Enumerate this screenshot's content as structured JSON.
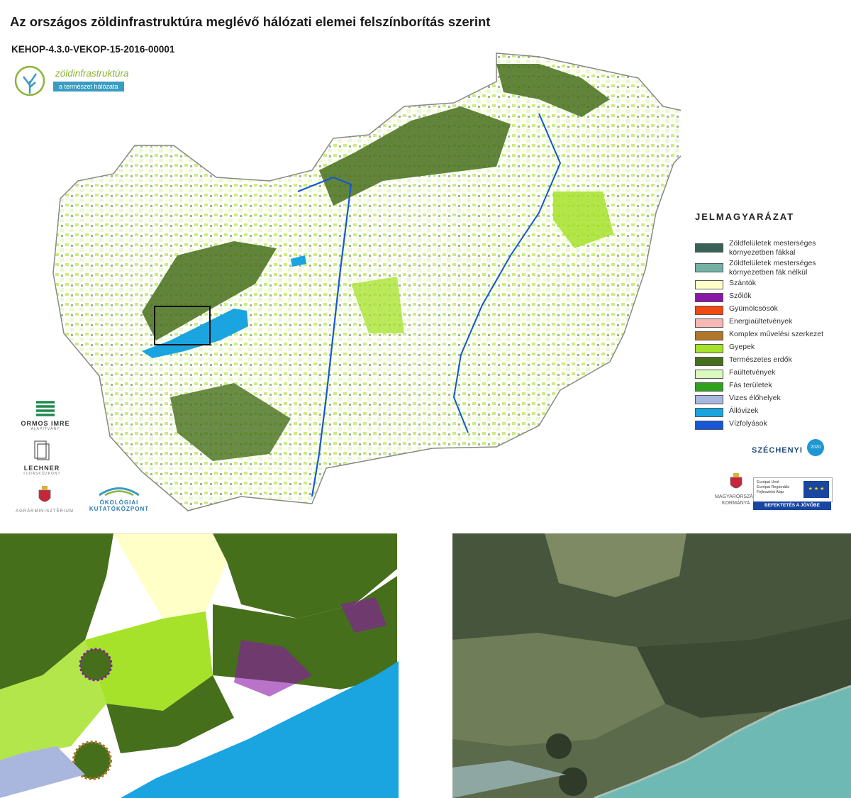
{
  "title": "Az országos zöldinfrastruktúra meglévő hálózati elemei felszínborítás szerint",
  "subtitle": "KEHOP-4.3.0-VEKOP-15-2016-00001",
  "logo": {
    "name": "zöldinfrastruktúra",
    "tagline": "a természet hálózata"
  },
  "legend": {
    "title": "JELMAGYARÁZAT",
    "items": [
      {
        "label": "Zöldfelületek mesterséges környezetben fákkal",
        "color": "#3a6158"
      },
      {
        "label": "Zöldfelületek mesterséges környezetben fák nélkül",
        "color": "#75b0a4"
      },
      {
        "label": "Szántók",
        "color": "#ffffc8"
      },
      {
        "label": "Szőlők",
        "color": "#8b17a6"
      },
      {
        "label": "Gyümölcsösök",
        "color": "#ef4a0f"
      },
      {
        "label": "Energiaültetvények",
        "color": "#f7b7b5"
      },
      {
        "label": "Komplex művelési szerkezet",
        "color": "#b0772a"
      },
      {
        "label": "Gyepek",
        "color": "#a6e22a"
      },
      {
        "label": "Természetes erdők",
        "color": "#466f1b"
      },
      {
        "label": "Faültetvények",
        "color": "#d9f9be"
      },
      {
        "label": "Fás területek",
        "color": "#2fa21c"
      },
      {
        "label": "Vizes élőhelyek",
        "color": "#a9b7df"
      },
      {
        "label": "Állóvizek",
        "color": "#1aa4e0"
      },
      {
        "label": "Vízfolyások",
        "color": "#1557d6"
      }
    ]
  },
  "partners": {
    "ormos": {
      "name": "ORMOS IMRE",
      "sub": "ALAPÍTVÁNY"
    },
    "lechner": {
      "name": "LECHNER",
      "sub": "TUDÁSKÖZPONT"
    },
    "ministry": "AGRÁRMINISZTÉRIUM",
    "okologiai": {
      "line1": "ÖKOLÓGIAI",
      "line2": "KUTATÓKÖZPONT"
    }
  },
  "funding": {
    "szechenyi": "SZÉCHENYI",
    "szechenyi_year": "2020",
    "gov": {
      "line1": "MAGYARORSZÁG",
      "line2": "KORMÁNYA"
    },
    "eu": {
      "line1": "Európai Unió",
      "line2": "Európai Regionális",
      "line3": "Fejlesztési Alap"
    },
    "invest": "BEFEKTETÉS A JÖVŐBE"
  },
  "colors": {
    "lake": "#1aa4e0",
    "forest": "#466f1b",
    "grass": "#a6e22a",
    "river": "#1557d6",
    "satellite_forest": "#3c4a34",
    "satellite_water": "#6fb9b4"
  }
}
